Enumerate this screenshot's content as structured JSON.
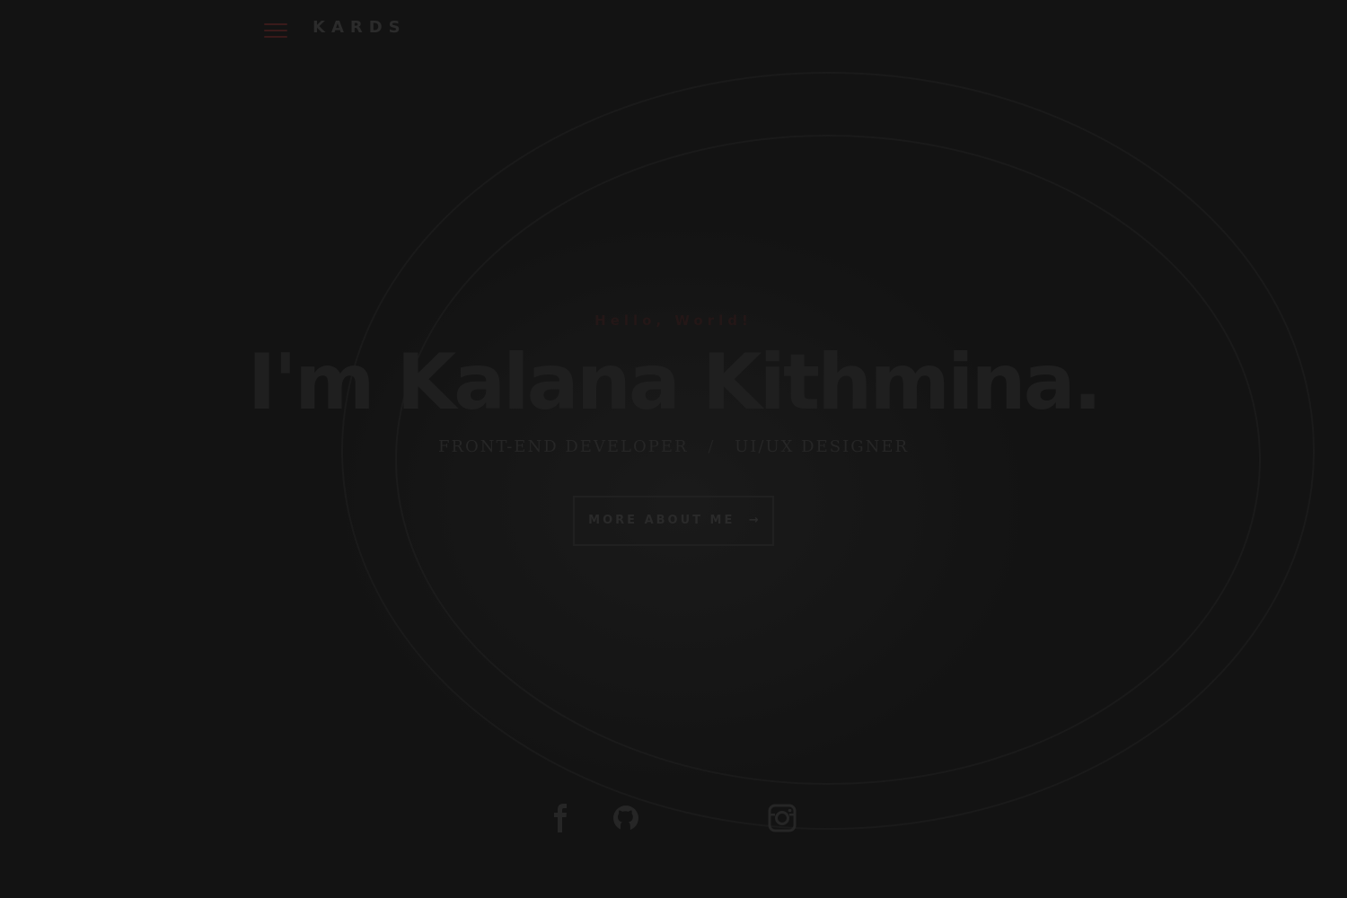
{
  "header": {
    "logo": "KARDS",
    "menu_icon": "hamburger-menu-icon"
  },
  "hero": {
    "greeting": "Hello, World!",
    "name": "I'm Kalana Kithmina.",
    "role_1": "FRONT-END DEVELOPER",
    "role_separator": "/",
    "role_2": "UI/UX DESIGNER",
    "cta_label": "MORE ABOUT ME",
    "cta_arrow": "→"
  },
  "social": {
    "items": [
      {
        "icon": "facebook-icon"
      },
      {
        "icon": "github-icon"
      },
      {
        "icon": "instagram-icon"
      }
    ]
  },
  "colors": {
    "background": "#131313",
    "accent": "#3a1a1a",
    "text_dim": "#2a2a2a"
  }
}
